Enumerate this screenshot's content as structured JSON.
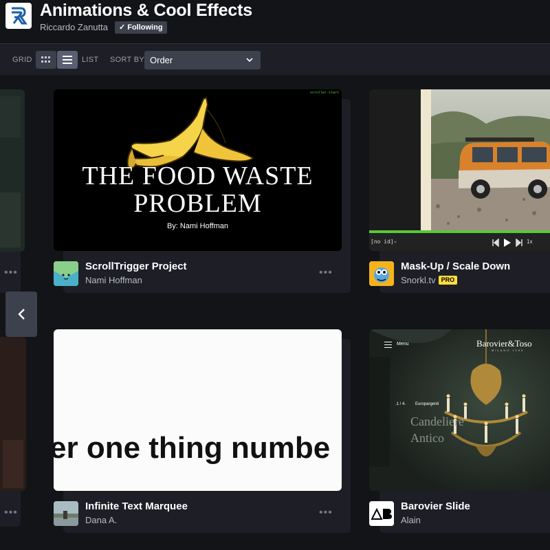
{
  "header": {
    "title": "Animations & Cool Effects",
    "owner": "Riccardo Zanutta",
    "follow_status": "Following"
  },
  "toolbar": {
    "grid_label": "GRID",
    "list_label": "LIST",
    "sort_label": "SORT BY",
    "sort_value": "Order"
  },
  "cards": [
    {
      "title": "ScrollTrigger Project",
      "author": "Nami Hoffman",
      "preview": {
        "headline_1": "THE FOOD WASTE",
        "headline_2": "PROBLEM",
        "byline": "By: Nami Hoffman",
        "corner_tag": "scroller-start"
      }
    },
    {
      "title": "Mask-Up / Scale Down",
      "author": "Snorkl.tv",
      "badge": "PRO",
      "preview": {
        "id_label": "[no id]",
        "speed": "1x"
      }
    },
    {
      "title": "Infinite Text Marquee",
      "author": "Dana A.",
      "preview": {
        "marquee_text": "er one thing numbe"
      }
    },
    {
      "title": "Barovier Slide",
      "author": "Alain",
      "preview": {
        "menu_label": "Menu",
        "brand": "Barovier&Toso",
        "brand_sub": "MILANO 1295",
        "counter": ".1 / 4.",
        "category": "Europargenti",
        "heading_1": "Candeliere",
        "heading_2": "Antico"
      }
    }
  ],
  "colors": {
    "page_bg": "#131417",
    "card_bg": "#1e1f26",
    "toolbar_bg": "#1e1f26",
    "control_bg": "#3d414d",
    "pro_badge": "#ffdd40",
    "progress_green": "#5ac83c",
    "van_orange": "#d9822b"
  }
}
